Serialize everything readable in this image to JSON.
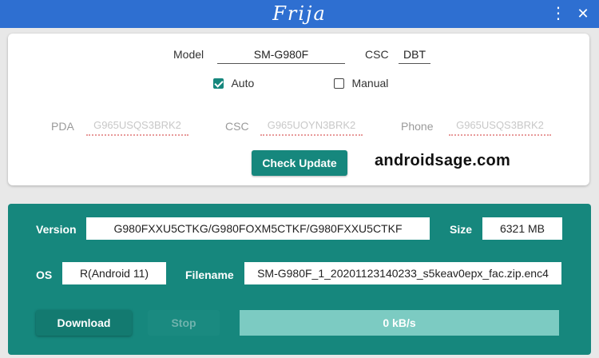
{
  "window": {
    "title": "Frija",
    "more_icon": "more-vert-icon",
    "close_icon": "close-icon"
  },
  "form": {
    "model_label": "Model",
    "model_value": "SM-G980F",
    "csc_label": "CSC",
    "csc_value": "DBT",
    "auto_label": "Auto",
    "auto_checked": true,
    "manual_label": "Manual",
    "manual_checked": false,
    "pda_label": "PDA",
    "pda_placeholder": "G965USQS3BRK2",
    "csc2_label": "CSC",
    "csc2_placeholder": "G965UOYN3BRK2",
    "phone_label": "Phone",
    "phone_placeholder": "G965USQS3BRK2",
    "check_update_label": "Check Update"
  },
  "watermark": "androidsage.com",
  "result": {
    "version_label": "Version",
    "version_value": "G980FXXU5CTKG/G980FOXM5CTKF/G980FXXU5CTKF",
    "size_label": "Size",
    "size_value": "6321 MB",
    "os_label": "OS",
    "os_value": "R(Android 11)",
    "filename_label": "Filename",
    "filename_value": "SM-G980F_1_20201123140233_s5keav0epx_fac.zip.enc4",
    "download_label": "Download",
    "stop_label": "Stop",
    "progress_text": "0 kB/s",
    "progress_fraction": 0
  },
  "colors": {
    "titlebar": "#2e6fd1",
    "accent": "#16877d",
    "progress_track": "#7ccbc2"
  }
}
